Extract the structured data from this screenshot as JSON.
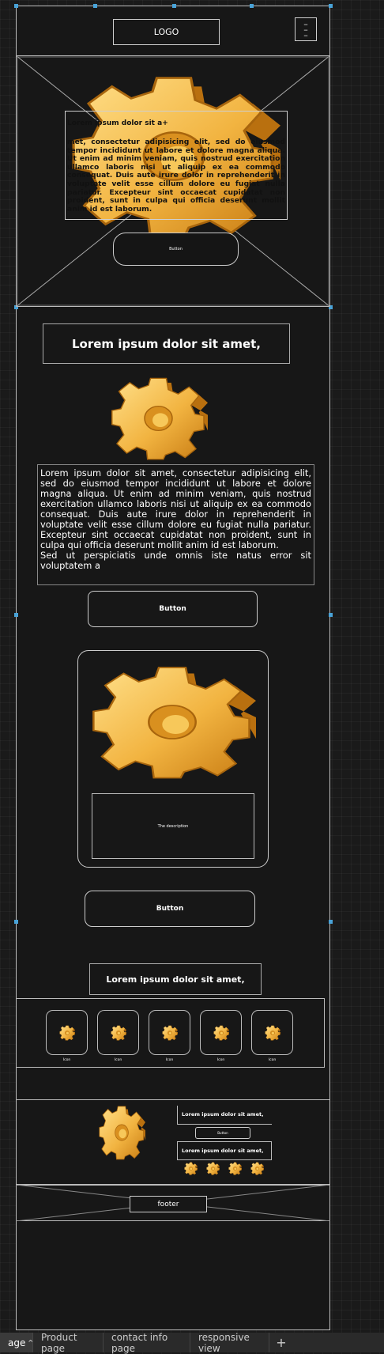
{
  "header": {
    "logo": "LOGO"
  },
  "hero": {
    "title": "Lorem ipsum dolor sit a+",
    "body": "met, consectetur adipisicing elit, sed do eiusmod tempor incididunt ut labore et dolore magna aliqua. Ut enim ad minim veniam, quis nostrud exercitation ullamco laboris nisi ut aliquip ex ea commodo consequat. Duis aute irure dolor in reprehenderit in voluptate velit esse cillum dolore eu fugiat nulla pariatur. Excepteur sint occaecat cupidatat non proident, sunt in culpa qui officia deserunt mollit anim id est laborum.",
    "button": "Button"
  },
  "main": {
    "heading": "Lorem ipsum dolor sit amet,",
    "paragraph": "Lorem ipsum dolor sit amet, consectetur adipisicing elit, sed do eiusmod tempor incididunt ut labore et dolore magna aliqua. Ut enim ad minim veniam, quis nostrud exercitation ullamco laboris nisi ut aliquip ex ea commodo consequat. Duis aute irure dolor in reprehenderit in voluptate velit esse cillum dolore eu fugiat nulla pariatur. Excepteur sint occaecat cupidatat non proident, sunt in culpa qui officia deserunt mollit anim id est laborum.",
    "paragraph2": "Sed ut perspiciatis unde omnis iste natus error sit voluptatem a",
    "button1": "Button",
    "card_description": "The description",
    "button2": "Button",
    "heading2": "Lorem ipsum dolor sit amet,"
  },
  "icons": {
    "items": [
      {
        "label": "Icon"
      },
      {
        "label": "Icon"
      },
      {
        "label": "Icon"
      },
      {
        "label": "Icon"
      },
      {
        "label": "Icon"
      }
    ]
  },
  "feature": {
    "title1": "Lorem ipsum dolor sit amet,",
    "button": "Button",
    "title2": "Lorem ipsum dolor sit amet,"
  },
  "footer": {
    "label": "footer"
  },
  "tabs": [
    {
      "label": "age"
    },
    {
      "label": "Product page"
    },
    {
      "label": "contact info page"
    },
    {
      "label": "responsive view"
    }
  ],
  "colors": {
    "gear_light": "#ffd86b",
    "gear_mid": "#f2b441",
    "gear_dark": "#c97d14",
    "canvas": "#1a1a1a"
  }
}
